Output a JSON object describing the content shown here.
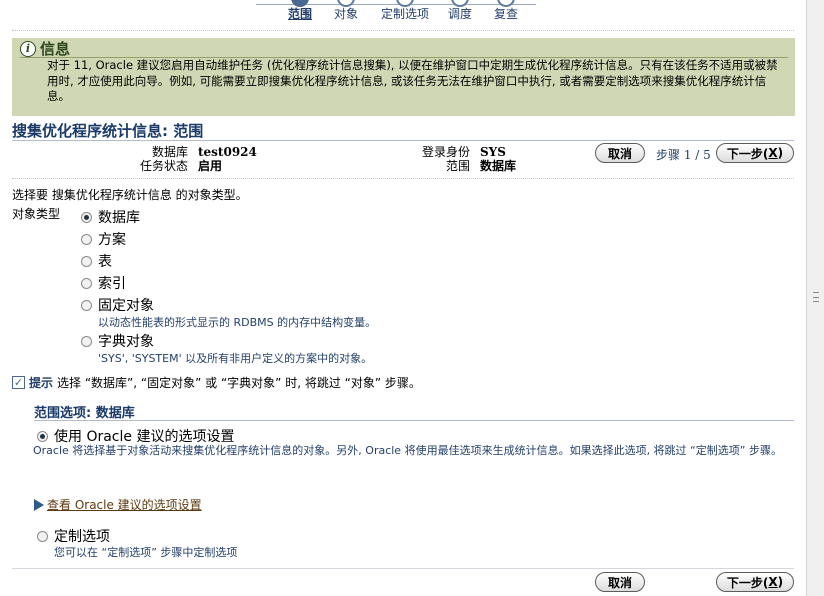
{
  "train": {
    "steps": [
      {
        "label": "范围"
      },
      {
        "label": "对象"
      },
      {
        "label": "定制选项"
      },
      {
        "label": "调度"
      },
      {
        "label": "复查"
      }
    ]
  },
  "info": {
    "title": "信息",
    "text": "对于 11, Oracle 建议您启用自动维护任务 (优化程序统计信息搜集), 以便在维护窗口中定期生成优化程序统计信息。只有在该任务不适用或被禁用时, 才应使用此向导。例如, 可能需要立即搜集优化程序统计信息, 或该任务无法在维护窗口中执行, 或者需要定制选项来搜集优化程序统计信息。"
  },
  "header": {
    "title": "搜集优化程序统计信息: 范围",
    "database_label": "数据库",
    "database_value": "test0924",
    "task_status_label": "任务状态",
    "task_status_value": "启用",
    "login_label": "登录身份",
    "login_value": "SYS",
    "scope_label": "范围",
    "scope_value": "数据库",
    "cancel_label": "取消",
    "step_label": "步骤",
    "step_value": "1 / 5",
    "next_label": "下一步(",
    "next_accel": "X",
    "next_close": ")"
  },
  "main": {
    "intro": "选择要 搜集优化程序统计信息 的对象类型。",
    "object_type_label": "对象类型",
    "options": [
      {
        "label": "数据库",
        "selected": true,
        "desc": ""
      },
      {
        "label": "方案",
        "selected": false,
        "desc": ""
      },
      {
        "label": "表",
        "selected": false,
        "desc": ""
      },
      {
        "label": "索引",
        "selected": false,
        "desc": ""
      },
      {
        "label": "固定对象",
        "selected": false,
        "desc": "以动态性能表的形式显示的 RDBMS 的内存中结构变量。"
      },
      {
        "label": "字典对象",
        "selected": false,
        "desc": "'SYS', 'SYSTEM' 以及所有非用户定义的方案中的对象。"
      }
    ],
    "tip_label": "提示",
    "tip_text": "选择 “数据库”, “固定对象” 或 “字典对象” 时, 将跳过 “对象” 步骤。"
  },
  "scope_options": {
    "title": "范围选项: 数据库",
    "use_oracle_label": "使用 Oracle 建议的选项设置",
    "use_oracle_desc": "Oracle 将选择基于对象活动来搜集优化程序统计信息的对象。另外, Oracle 将使用最佳选项来生成统计信息。如果选择此选项, 将跳过 “定制选项” 步骤。",
    "view_link": "查看 Oracle 建议的选项设置",
    "custom_label": "定制选项",
    "custom_desc": "您可以在 “定制选项” 步骤中定制选项"
  },
  "footer": {
    "cancel_label": "取消",
    "next_label": "下一步(",
    "next_accel": "X",
    "next_close": ")"
  }
}
